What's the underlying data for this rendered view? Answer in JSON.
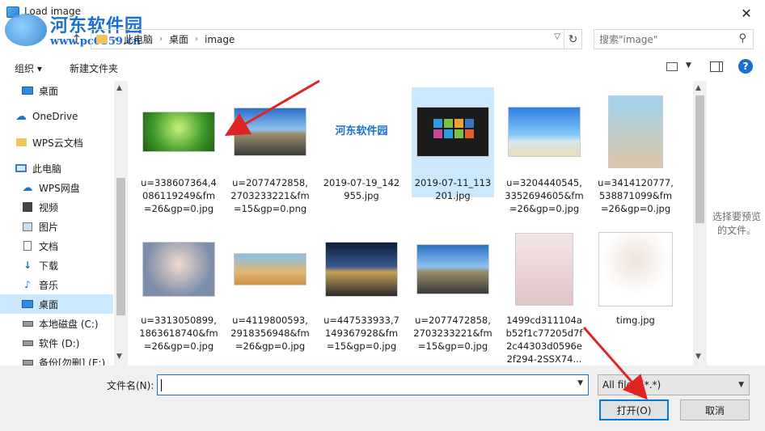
{
  "window": {
    "title": "Load image",
    "close_glyph": "✕"
  },
  "watermark": {
    "name": "河东软件园",
    "url": "www.pc0359.cn"
  },
  "address": {
    "crumbs": [
      "此电脑",
      "桌面",
      "image"
    ],
    "search_placeholder": "搜索\"image\""
  },
  "toolbar": {
    "organize": "组织 ▾",
    "new_folder": "新建文件夹",
    "help": "?"
  },
  "sidebar": {
    "items": [
      {
        "label": "桌面",
        "icon": "desktop-icon"
      },
      {
        "label": "OneDrive",
        "icon": "cloud-icon"
      },
      {
        "label": "WPS云文档",
        "icon": "folder-icon"
      },
      {
        "label": "此电脑",
        "icon": "computer-icon"
      },
      {
        "label": "WPS网盘",
        "icon": "cloud-outline-icon"
      },
      {
        "label": "视频",
        "icon": "video-icon"
      },
      {
        "label": "图片",
        "icon": "picture-icon"
      },
      {
        "label": "文档",
        "icon": "document-icon"
      },
      {
        "label": "下载",
        "icon": "download-icon"
      },
      {
        "label": "音乐",
        "icon": "music-icon"
      },
      {
        "label": "桌面",
        "icon": "desktop-icon"
      },
      {
        "label": "本地磁盘 (C:)",
        "icon": "drive-icon"
      },
      {
        "label": "软件 (D:)",
        "icon": "drive-icon"
      },
      {
        "label": "备份[勿删] (E:)",
        "icon": "drive-icon"
      }
    ],
    "selected_index": 10
  },
  "files": [
    {
      "name": "u=338607364,4086119249&fm=26&gp=0.jpg"
    },
    {
      "name": "u=2077472858,2703233221&fm=15&gp=0.png"
    },
    {
      "name": "2019-07-19_142955.jpg"
    },
    {
      "name": "2019-07-11_113201.jpg"
    },
    {
      "name": "u=3204440545,3352694605&fm=26&gp=0.jpg"
    },
    {
      "name": "u=3414120777,538871099&fm=26&gp=0.jpg"
    },
    {
      "name": "u=3313050899,1863618740&fm=26&gp=0.jpg"
    },
    {
      "name": "u=4119800593,2918356948&fm=26&gp=0.jpg"
    },
    {
      "name": "u=447533933,7149367928&fm=15&gp=0.jpg"
    },
    {
      "name": "u=2077472858,2703233221&fm=15&gp=0.jpg"
    },
    {
      "name": "1499cd311104ab52f1c77205d7f2c44303d0596e2f294-2SSX74..."
    },
    {
      "name": "timg.jpg"
    }
  ],
  "selected_file_index": 3,
  "preview": {
    "message": "选择要预览的文件。"
  },
  "thumb_watermark": "河东软件园",
  "bottom": {
    "filename_label": "文件名(N):",
    "filename_value": "",
    "filter": "All files (*.*)",
    "open": "打开(O)",
    "cancel": "取消"
  }
}
